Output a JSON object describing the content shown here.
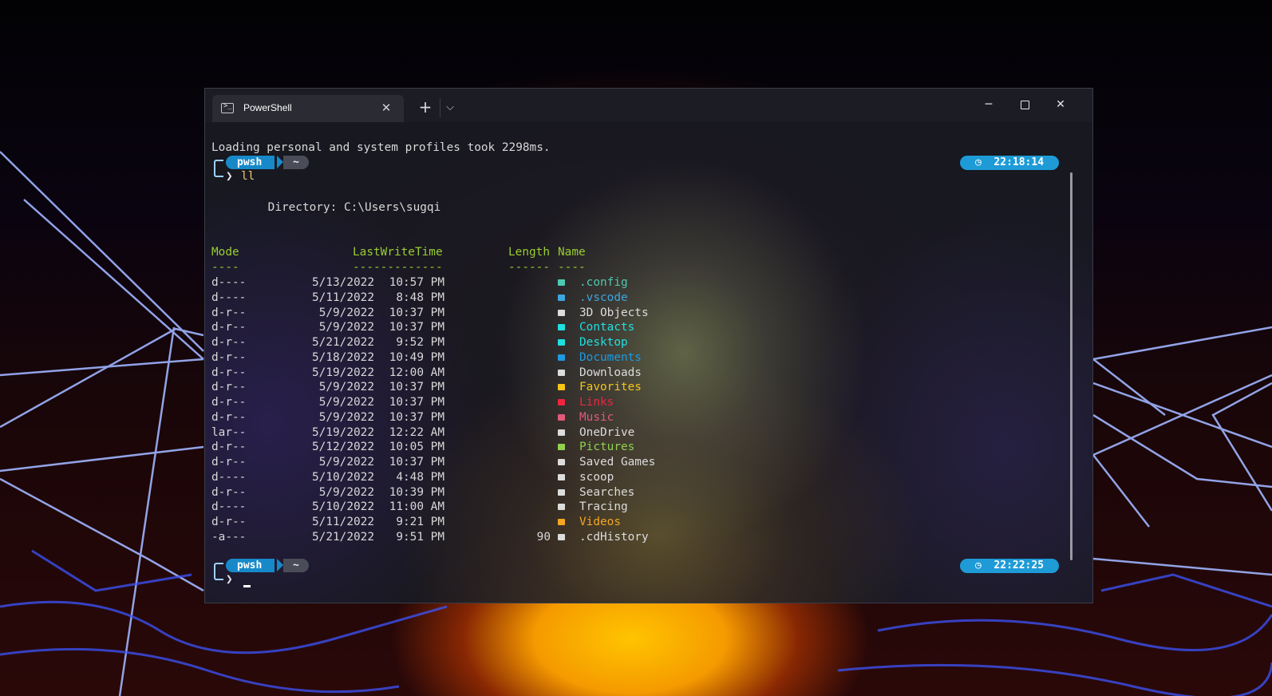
{
  "window": {
    "tab_title": "PowerShell",
    "tab_close": "✕",
    "new_tab": "+",
    "dropdown": "⌵",
    "minimize": "─",
    "close": "✕"
  },
  "terminal": {
    "loading_message": "Loading personal and system profiles took 2298ms.",
    "prompt1": {
      "shell": "pwsh",
      "path": "~",
      "command": "ll",
      "time": "22:18:14"
    },
    "directory_line": "    Directory: C:\\Users\\sugqi",
    "headers": {
      "mode": "Mode",
      "lastwrite": "LastWriteTime",
      "length": "Length",
      "name": "Name"
    },
    "header_dashes": {
      "mode": "----",
      "lastwrite": "-------------",
      "length": "------",
      "name": "----"
    },
    "entries": [
      {
        "mode": "d----",
        "date": "5/13/2022",
        "time": "10:57 PM",
        "length": "",
        "name": ".config",
        "color": "#4ec9b0",
        "icon": "gear-icon"
      },
      {
        "mode": "d----",
        "date": "5/11/2022",
        "time": "8:48 PM",
        "length": "",
        "name": ".vscode",
        "color": "#3da5e0",
        "icon": "vscode-folder-icon"
      },
      {
        "mode": "d-r--",
        "date": "5/9/2022",
        "time": "10:37 PM",
        "length": "",
        "name": "3D Objects",
        "color": "#dcdcdc",
        "icon": "folder-icon"
      },
      {
        "mode": "d-r--",
        "date": "5/9/2022",
        "time": "10:37 PM",
        "length": "",
        "name": "Contacts",
        "color": "#1ee0e0",
        "icon": "contacts-icon"
      },
      {
        "mode": "d-r--",
        "date": "5/21/2022",
        "time": "9:52 PM",
        "length": "",
        "name": "Desktop",
        "color": "#1ee0e0",
        "icon": "desktop-icon"
      },
      {
        "mode": "d-r--",
        "date": "5/18/2022",
        "time": "10:49 PM",
        "length": "",
        "name": "Documents",
        "color": "#1e9be0",
        "icon": "documents-icon"
      },
      {
        "mode": "d-r--",
        "date": "5/19/2022",
        "time": "12:00 AM",
        "length": "",
        "name": "Downloads",
        "color": "#dcdcdc",
        "icon": "downloads-icon"
      },
      {
        "mode": "d-r--",
        "date": "5/9/2022",
        "time": "10:37 PM",
        "length": "",
        "name": "Favorites",
        "color": "#f5c518",
        "icon": "favorites-icon"
      },
      {
        "mode": "d-r--",
        "date": "5/9/2022",
        "time": "10:37 PM",
        "length": "",
        "name": "Links",
        "color": "#f02540",
        "icon": "links-icon"
      },
      {
        "mode": "d-r--",
        "date": "5/9/2022",
        "time": "10:37 PM",
        "length": "",
        "name": "Music",
        "color": "#e05a7a",
        "icon": "music-icon"
      },
      {
        "mode": "lar--",
        "date": "5/19/2022",
        "time": "12:22 AM",
        "length": "",
        "name": "OneDrive",
        "color": "#dcdcdc",
        "icon": "cloud-icon"
      },
      {
        "mode": "d-r--",
        "date": "5/12/2022",
        "time": "10:05 PM",
        "length": "",
        "name": "Pictures",
        "color": "#8fd14f",
        "icon": "pictures-icon"
      },
      {
        "mode": "d-r--",
        "date": "5/9/2022",
        "time": "10:37 PM",
        "length": "",
        "name": "Saved Games",
        "color": "#dcdcdc",
        "icon": "folder-icon"
      },
      {
        "mode": "d----",
        "date": "5/10/2022",
        "time": "4:48 PM",
        "length": "",
        "name": "scoop",
        "color": "#dcdcdc",
        "icon": "folder-icon"
      },
      {
        "mode": "d-r--",
        "date": "5/9/2022",
        "time": "10:39 PM",
        "length": "",
        "name": "Searches",
        "color": "#dcdcdc",
        "icon": "folder-icon"
      },
      {
        "mode": "d----",
        "date": "5/10/2022",
        "time": "11:00 AM",
        "length": "",
        "name": "Tracing",
        "color": "#dcdcdc",
        "icon": "folder-icon"
      },
      {
        "mode": "d-r--",
        "date": "5/11/2022",
        "time": "9:21 PM",
        "length": "",
        "name": "Videos",
        "color": "#f5a623",
        "icon": "videos-icon"
      },
      {
        "mode": "-a---",
        "date": "5/21/2022",
        "time": "9:51 PM",
        "length": "90",
        "name": ".cdHistory",
        "color": "#dcdcdc",
        "icon": "file-icon"
      }
    ],
    "prompt2": {
      "shell": "pwsh",
      "path": "~",
      "time": "22:22:25"
    },
    "chevron": "❯",
    "clock_glyph": "◷"
  },
  "colors": {
    "prompt_blue": "#1789c9",
    "time_badge": "#1e9bd7",
    "header_green": "#9acd32",
    "command_yellow": "#f0c674"
  }
}
